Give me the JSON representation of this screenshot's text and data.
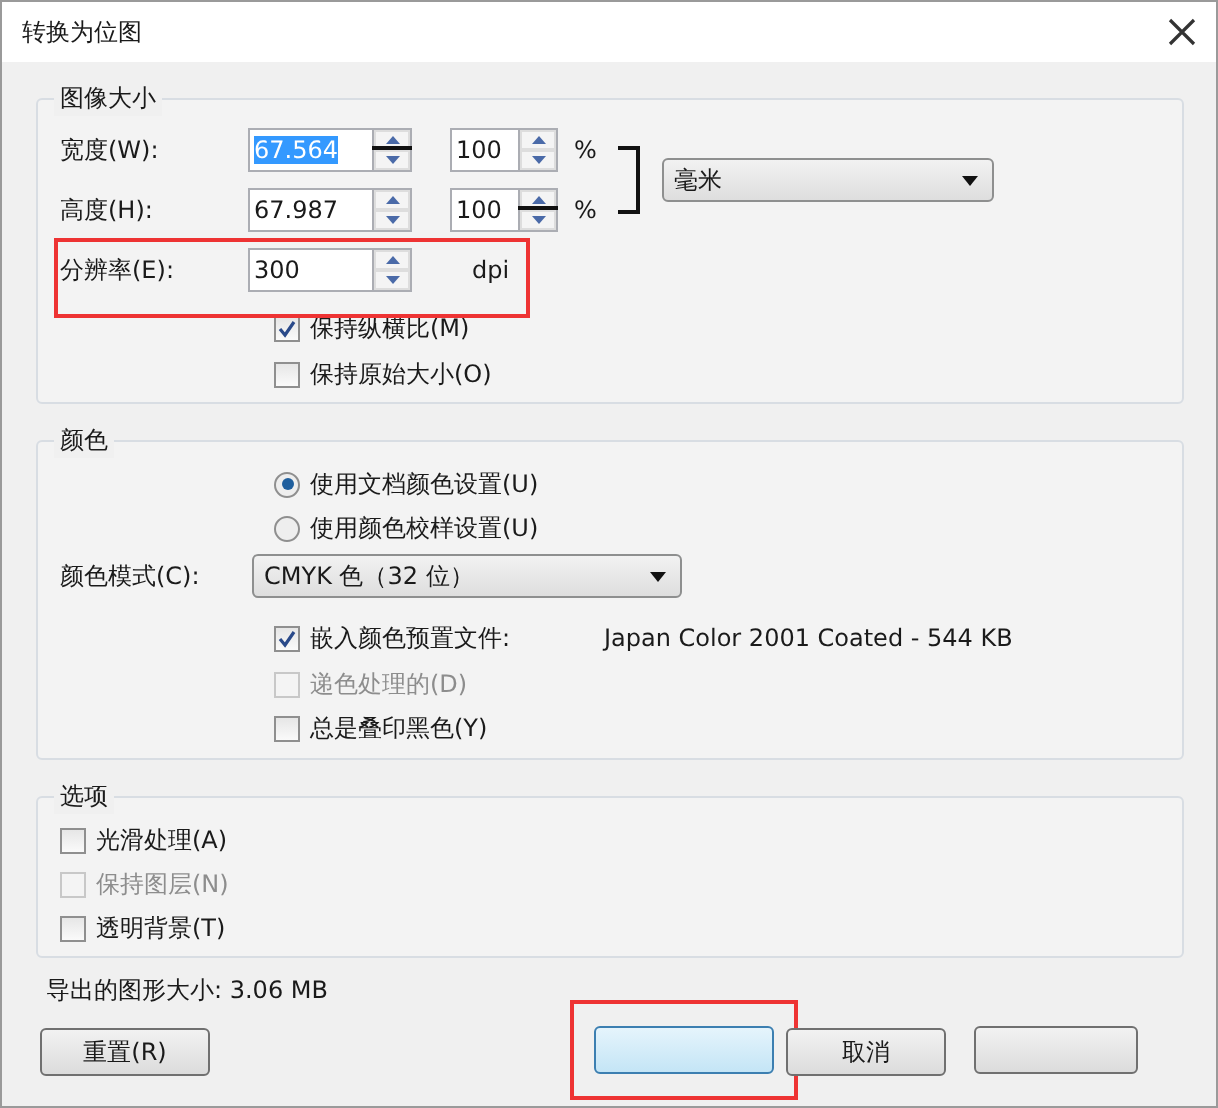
{
  "window": {
    "title": "转换为位图"
  },
  "image_size": {
    "title": "图像大小",
    "rows": [
      {
        "label": "宽度(W):",
        "value": "67.564",
        "value_selected": true,
        "linked": true,
        "percent": "100",
        "percent_linked": false,
        "unit": "%"
      },
      {
        "label": "高度(H):",
        "value": "67.987",
        "value_selected": false,
        "linked": false,
        "percent": "100",
        "percent_linked": true,
        "unit": "%"
      }
    ],
    "units": "毫米",
    "resolution": {
      "label": "分辨率(E):",
      "value": "300",
      "unit": "dpi",
      "highlighted": true
    },
    "checkboxes": [
      {
        "label": "保持纵横比(M)",
        "checked": true,
        "disabled": false
      },
      {
        "label": "保持原始大小(O)",
        "checked": false,
        "disabled": false
      }
    ]
  },
  "color": {
    "title": "颜色",
    "radios": [
      {
        "label": "使用文档颜色设置(U)",
        "selected": true
      },
      {
        "label": "使用颜色校样设置(U)",
        "selected": false
      }
    ],
    "mode_label": "颜色模式(C):",
    "mode": "CMYK 色（32 位）",
    "checkboxes": [
      {
        "label": "嵌入颜色预置文件:",
        "checked": true,
        "disabled": false,
        "detail": "Japan Color 2001 Coated - 544 KB"
      },
      {
        "label": "递色处理的(D)",
        "checked": false,
        "disabled": true
      },
      {
        "label": "总是叠印黑色(Y)",
        "checked": false,
        "disabled": false
      }
    ]
  },
  "options": {
    "title": "选项",
    "checkboxes": [
      {
        "label": "光滑处理(A)",
        "checked": false,
        "disabled": false
      },
      {
        "label": "保持图层(N)",
        "checked": false,
        "disabled": true
      },
      {
        "label": "透明背景(T)",
        "checked": false,
        "disabled": false
      }
    ]
  },
  "export_size": "导出的图形大小: 3.06 MB",
  "buttons": [
    {
      "kind": "plain",
      "label": "重置(R)",
      "highlighted": false
    },
    {
      "kind": "default",
      "highlighted": true
    },
    {
      "kind": "plain",
      "label": "取消",
      "highlighted": false
    },
    {
      "kind": "plain",
      "highlighted": false
    }
  ]
}
